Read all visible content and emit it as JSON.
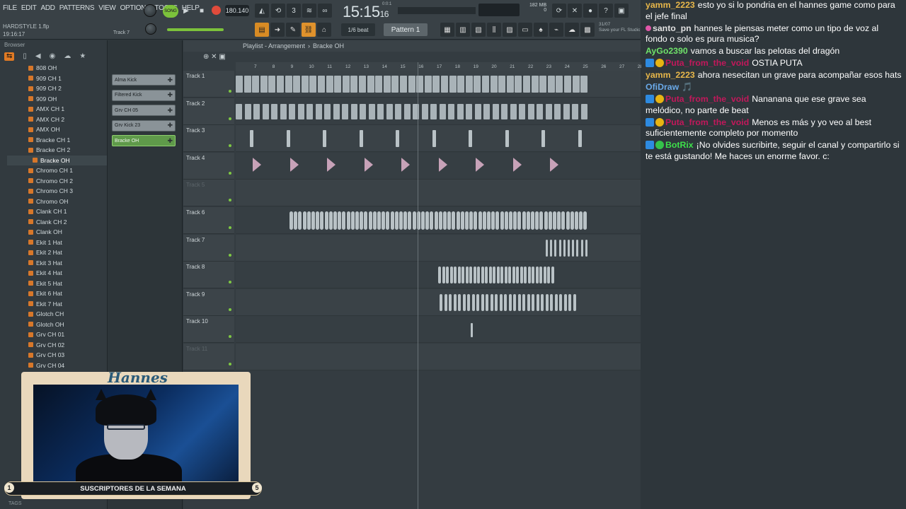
{
  "menu": [
    "FILE",
    "EDIT",
    "ADD",
    "PATTERNS",
    "VIEW",
    "OPTIONS",
    "TOOLS",
    "HELP"
  ],
  "project": {
    "file": "HARDSTYLE 1.flp",
    "time": "19:16:17",
    "track_hint": "Track 7"
  },
  "transport": {
    "song_label": "SONG",
    "tempo": "180.140"
  },
  "clock": {
    "main": "15:15",
    "sub": "16",
    "beats": "0:0:1"
  },
  "memory": {
    "mb": "182 MB",
    "val": "0"
  },
  "snap": "1/6 beat",
  "pattern": "Pattern 1",
  "hint": {
    "date": "31/07",
    "text": "Save your FL Studio projects to the cloud"
  },
  "browser": {
    "title": "Browser",
    "items": [
      "808 OH",
      "909 CH 1",
      "909 CH 2",
      "909 OH",
      "AMX CH 1",
      "AMX CH 2",
      "AMX OH",
      "Bracke CH 1",
      "Bracke CH 2",
      "Bracke OH",
      "Chromo CH 1",
      "Chromo CH 2",
      "Chromo CH 3",
      "Chromo OH",
      "Clank CH 1",
      "Clank CH 2",
      "Clank OH",
      "Ekit 1 Hat",
      "Ekit 2 Hat",
      "Ekit 3 Hat",
      "Ekit 4 Hat",
      "Ekit 5 Hat",
      "Ekit 6 Hat",
      "Ekit 7 Hat",
      "Glotch CH",
      "Glotch OH",
      "Grv CH 01",
      "Grv CH 02",
      "Grv CH 03",
      "Grv CH 04"
    ],
    "selected": "Bracke OH",
    "footer": "TAGS"
  },
  "channels": [
    {
      "name": "Alma Kick",
      "active": false
    },
    {
      "name": "Filtered Kick",
      "active": false
    },
    {
      "name": "Grv CH 05",
      "active": false
    },
    {
      "name": "Grv Kick 23",
      "active": false
    },
    {
      "name": "Bracke OH",
      "active": true
    }
  ],
  "playlist": {
    "title": "Playlist - Arrangement",
    "crumb": "Bracke OH",
    "ruler": [
      "7",
      "8",
      "9",
      "10",
      "11",
      "12",
      "13",
      "14",
      "15",
      "16",
      "17",
      "18",
      "19",
      "20",
      "21",
      "22",
      "23",
      "24",
      "25",
      "26",
      "27",
      "28",
      "29",
      "30",
      "31",
      "32",
      "33",
      "34",
      "35",
      "36",
      "37",
      "38",
      "39",
      "40",
      "41"
    ],
    "tracks": [
      "Track 1",
      "Track 2",
      "Track 3",
      "Track 4",
      "Track 5",
      "Track 6",
      "Track 7",
      "Track 8",
      "Track 9",
      "Track 10",
      "Track 11"
    ]
  },
  "webcam": {
    "name": "Hannes",
    "banner": "SUSCRIPTORES DE LA SEMANA",
    "left_num": "1",
    "right_num": "5"
  },
  "chat": [
    {
      "user": "yamm_2223",
      "color": "#e8b74a",
      "badges": [],
      "text": "esto yo si lo pondria en el hannes game como para el jefe final"
    },
    {
      "user": "santo_pn",
      "color": "#e2e2e2",
      "badges": [
        "pink"
      ],
      "text": "hannes le piensas meter como un tipo de voz al fondo o solo es pura musica?"
    },
    {
      "user": "AyGo2390",
      "color": "#6fe36a",
      "badges": [],
      "text": "vamos a buscar las pelotas del dragón"
    },
    {
      "user": "Puta_from_the_void",
      "color": "#c2185b",
      "badges": [
        "blue",
        "gold"
      ],
      "text": "OSTIA PUTA"
    },
    {
      "user": "yamm_2223",
      "color": "#e8b74a",
      "badges": [],
      "text": "ahora nesecitan un grave para acompañar esos hats"
    },
    {
      "user": "OfiDraw",
      "color": "#6aa9e8",
      "badges": [],
      "text": "🎵"
    },
    {
      "user": "Puta_from_the_void",
      "color": "#c2185b",
      "badges": [
        "blue",
        "gold"
      ],
      "text": "Nananana que ese grave sea melódico, no parte de beat"
    },
    {
      "user": "Puta_from_the_void",
      "color": "#c2185b",
      "badges": [
        "blue",
        "gold"
      ],
      "text": "Menos es más y yo veo al best suficientemente completo por momento"
    },
    {
      "user": "BotRix",
      "color": "#3ee04b",
      "badges": [
        "blue",
        "green"
      ],
      "text": "¡No olvides sucribirte, seguir el canal y compartirlo si te está gustando! Me haces un enorme favor. c:"
    }
  ]
}
